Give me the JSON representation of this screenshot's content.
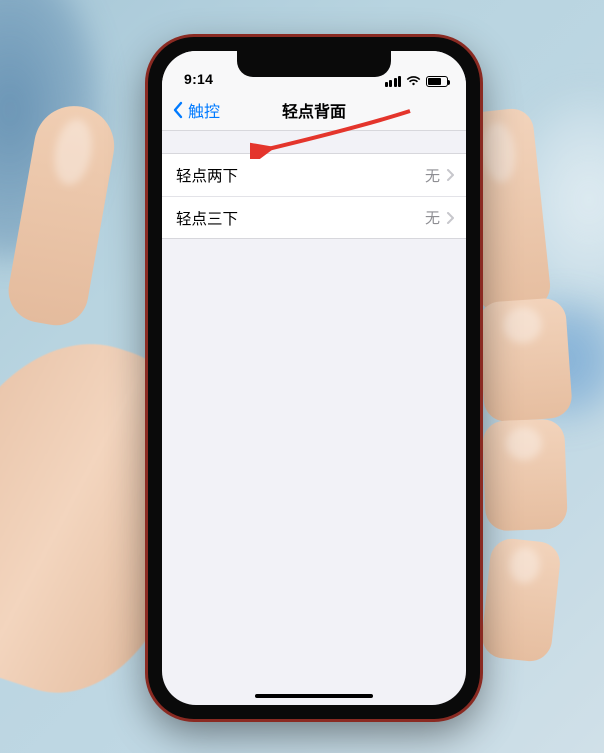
{
  "statusBar": {
    "time": "9:14"
  },
  "nav": {
    "back": "触控",
    "title": "轻点背面"
  },
  "rows": [
    {
      "label": "轻点两下",
      "value": "无"
    },
    {
      "label": "轻点三下",
      "value": "无"
    }
  ]
}
